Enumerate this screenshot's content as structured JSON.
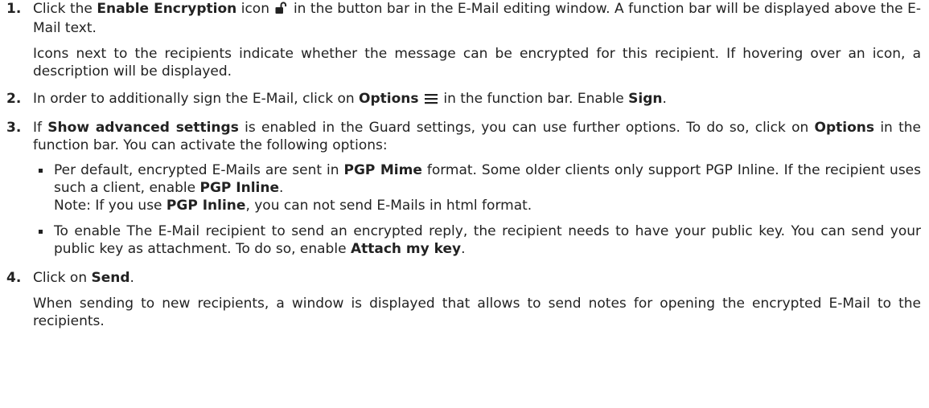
{
  "steps": [
    {
      "number": "1.",
      "parts": {
        "a": "Click the ",
        "b": "Enable Encryption",
        "c": " icon ",
        "d": " in the button bar in the E-Mail editing window. A function bar will be displayed above the E-Mail text."
      },
      "icon": "unlocked-padlock-icon",
      "note": "Icons next to the recipients indicate whether the message can be encrypted for this recipient. If hovering over an icon, a description will be displayed."
    },
    {
      "number": "2.",
      "parts": {
        "a": "In order to additionally sign the E-Mail, click on ",
        "b": "Options",
        "c": " in the function bar. Enable ",
        "d": "Sign",
        "e": "."
      },
      "icon": "hamburger-menu-icon"
    },
    {
      "number": "3.",
      "parts": {
        "a": "If ",
        "b": "Show advanced settings",
        "c": " is enabled in the Guard settings, you can use further options. To do so, click on ",
        "d": "Options",
        "e": " in the function bar. You can activate the following options:"
      },
      "bullets": [
        {
          "parts": {
            "a": "Per default, encrypted E-Mails are sent in ",
            "b": "PGP Mime",
            "c": " format. Some older clients only support PGP Inline. If the recipient uses such a client, enable ",
            "d": "PGP Inline",
            "e": "."
          },
          "note": {
            "a": "Note: If you use ",
            "b": "PGP Inline",
            "c": ", you can not send E-Mails in html format."
          }
        },
        {
          "parts": {
            "a": "To enable The E-Mail recipient to send an encrypted reply, the recipient needs to have your public key. You can send your public key as attachment. To do so, enable ",
            "b": "Attach my key",
            "c": "."
          }
        }
      ]
    },
    {
      "number": "4.",
      "parts": {
        "a": "Click on ",
        "b": "Send",
        "c": "."
      },
      "note": "When sending to new recipients, a window is displayed that allows to send notes for opening the encrypted E-Mail to the recipients."
    }
  ]
}
